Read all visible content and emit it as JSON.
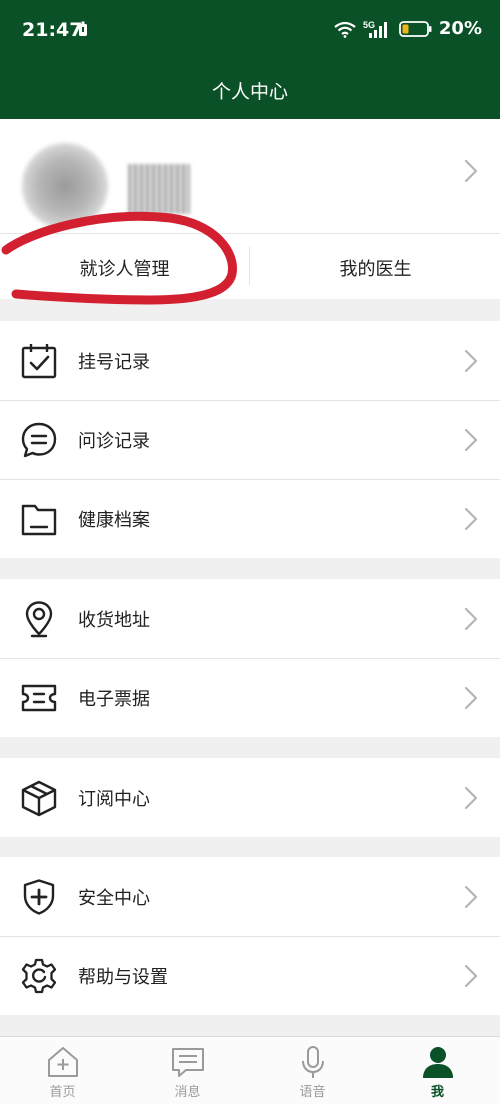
{
  "status": {
    "time": "21:47",
    "network": "5G",
    "battery": "20%"
  },
  "header": {
    "title": "个人中心"
  },
  "profile": {
    "tabs": [
      {
        "label": "就诊人管理"
      },
      {
        "label": "我的医生"
      }
    ]
  },
  "menu": {
    "groups": [
      {
        "items": [
          {
            "label": "挂号记录",
            "icon": "calendar-check-icon"
          },
          {
            "label": "问诊记录",
            "icon": "chat-bubble-icon"
          },
          {
            "label": "健康档案",
            "icon": "folder-icon"
          }
        ]
      },
      {
        "items": [
          {
            "label": "收货地址",
            "icon": "location-pin-icon"
          },
          {
            "label": "电子票据",
            "icon": "ticket-icon"
          }
        ]
      },
      {
        "items": [
          {
            "label": "订阅中心",
            "icon": "cube-icon"
          }
        ]
      },
      {
        "items": [
          {
            "label": "安全中心",
            "icon": "shield-plus-icon"
          },
          {
            "label": "帮助与设置",
            "icon": "gear-icon"
          }
        ]
      }
    ]
  },
  "tabbar": {
    "items": [
      {
        "label": "首页",
        "icon": "home-icon"
      },
      {
        "label": "消息",
        "icon": "message-icon"
      },
      {
        "label": "语音",
        "icon": "microphone-icon"
      },
      {
        "label": "我",
        "icon": "user-icon",
        "active": true
      }
    ]
  },
  "colors": {
    "brand": "#0b5127",
    "annotation": "#d32030",
    "chevron": "#b5b5b5"
  }
}
